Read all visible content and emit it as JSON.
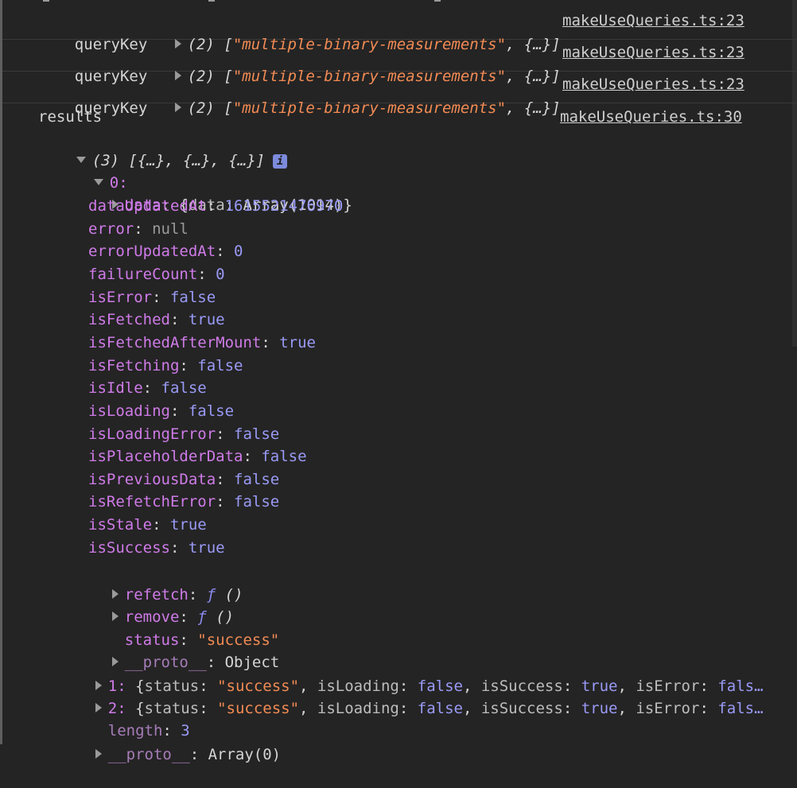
{
  "logs": [
    {
      "label": "queryKey",
      "summary_count": "(2)",
      "open": "[",
      "str": "\"multiple-binary-measurements\"",
      "rest": ", {…}]",
      "source": "makeUseQueries.ts:23"
    },
    {
      "label": "queryKey",
      "summary_count": "(2)",
      "open": "[",
      "str": "\"multiple-binary-measurements\"",
      "rest": ", {…}]",
      "source": "makeUseQueries.ts:23"
    },
    {
      "label": "queryKey",
      "summary_count": "(2)",
      "open": "[",
      "str": "\"multiple-binary-measurements\"",
      "rest": ", {…}]",
      "source": "makeUseQueries.ts:23"
    }
  ],
  "results": {
    "label": "results",
    "source": "makeUseQueries.ts:30",
    "summary": "(3) [{…}, {…}, {…}]",
    "info_icon": "i",
    "item0": {
      "key": "0:",
      "data_key": "data",
      "data_val": "{data: Array(1014)}",
      "data_inner_key": "data",
      "props": [
        {
          "k": "dataUpdatedAt",
          "v": "1615521476970",
          "t": "num"
        },
        {
          "k": "error",
          "v": "null",
          "t": "null"
        },
        {
          "k": "errorUpdatedAt",
          "v": "0",
          "t": "num"
        },
        {
          "k": "failureCount",
          "v": "0",
          "t": "num"
        },
        {
          "k": "isError",
          "v": "false",
          "t": "kw"
        },
        {
          "k": "isFetched",
          "v": "true",
          "t": "kw"
        },
        {
          "k": "isFetchedAfterMount",
          "v": "true",
          "t": "kw"
        },
        {
          "k": "isFetching",
          "v": "false",
          "t": "kw"
        },
        {
          "k": "isIdle",
          "v": "false",
          "t": "kw"
        },
        {
          "k": "isLoading",
          "v": "false",
          "t": "kw"
        },
        {
          "k": "isLoadingError",
          "v": "false",
          "t": "kw"
        },
        {
          "k": "isPlaceholderData",
          "v": "false",
          "t": "kw"
        },
        {
          "k": "isPreviousData",
          "v": "false",
          "t": "kw"
        },
        {
          "k": "isRefetchError",
          "v": "false",
          "t": "kw"
        },
        {
          "k": "isStale",
          "v": "true",
          "t": "kw"
        },
        {
          "k": "isSuccess",
          "v": "true",
          "t": "kw"
        }
      ],
      "refetch_key": "refetch",
      "fn_sym": "ƒ",
      "fn_args": "()",
      "remove_key": "remove",
      "status_key": "status",
      "status_val": "\"success\"",
      "proto_key": "__proto__",
      "proto_val": "Object"
    },
    "item1": {
      "key": "1:",
      "status_val": "\"success\"",
      "isLoading": "false",
      "isSuccess": "true",
      "isError": "fals…"
    },
    "item2": {
      "key": "2:",
      "status_val": "\"success\"",
      "isLoading": "false",
      "isSuccess": "true",
      "isError": "fals…"
    },
    "length_key": "length",
    "length_val": "3",
    "proto_key": "__proto__",
    "proto_val": "Array(0)"
  },
  "colors": {
    "background": "#242424",
    "property": "#cf7be8",
    "string": "#f28b54",
    "number": "#9a9af7"
  }
}
